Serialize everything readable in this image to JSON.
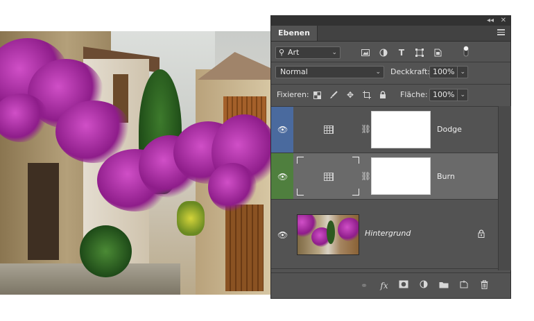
{
  "panel": {
    "tab_label": "Ebenen",
    "filter": {
      "label": "Art"
    },
    "blend_mode": "Normal",
    "opacity": {
      "label": "Deckkraft:",
      "value": "100%"
    },
    "lock_label": "Fixieren:",
    "fill": {
      "label": "Fläche:",
      "value": "100%"
    }
  },
  "layers": [
    {
      "name": "Dodge",
      "color": "#4a6a9e",
      "selected": false
    },
    {
      "name": "Burn",
      "color": "#4f7f3e",
      "selected": true
    },
    {
      "name": "Hintergrund",
      "color": null,
      "selected": false,
      "locked": true
    }
  ],
  "icons": {
    "collapse": "double-chevron-icon",
    "close": "close-icon",
    "search": "search-icon",
    "eye": "eye-icon",
    "link": "chain-link-icon",
    "fx": "fx-icon",
    "mask": "add-mask-icon",
    "adjustment": "adjustment-layer-icon",
    "folder": "new-group-icon",
    "new_layer": "new-layer-icon",
    "trash": "trash-icon"
  },
  "bottom_fx_label": "fx"
}
